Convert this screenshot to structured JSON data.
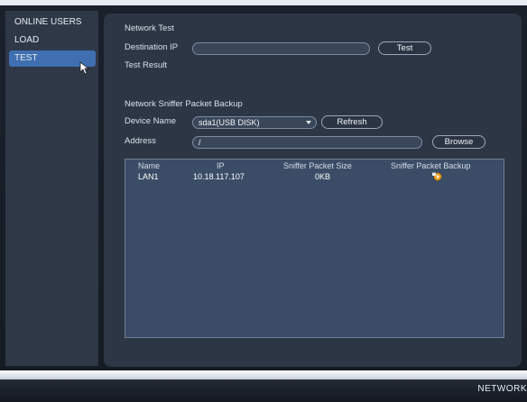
{
  "sidebar": {
    "items": [
      {
        "label": "ONLINE USERS"
      },
      {
        "label": "LOAD"
      },
      {
        "label": "TEST"
      }
    ]
  },
  "network_test": {
    "title": "Network Test",
    "destination_label": "Destination IP",
    "destination_value": "",
    "test_button": "Test",
    "result_label": "Test Result"
  },
  "sniffer": {
    "title": "Network Sniffer Packet Backup",
    "device_label": "Device Name",
    "device_value": "sda1(USB DISK)",
    "refresh_button": "Refresh",
    "address_label": "Address",
    "address_value": "/",
    "browse_button": "Browse",
    "columns": [
      "Name",
      "IP",
      "Sniffer Packet Size",
      "Sniffer Packet Backup"
    ],
    "rows": [
      {
        "name": "LAN1",
        "ip": "10.18.117.107",
        "size": "0KB",
        "backup_icon": "backup-start-icon"
      }
    ]
  },
  "footer": {
    "label": "NETWORK"
  },
  "colors": {
    "accent": "#3f6fb0",
    "panel": "#2d3644",
    "table": "#3b4d66",
    "icon": "#f0a020"
  }
}
